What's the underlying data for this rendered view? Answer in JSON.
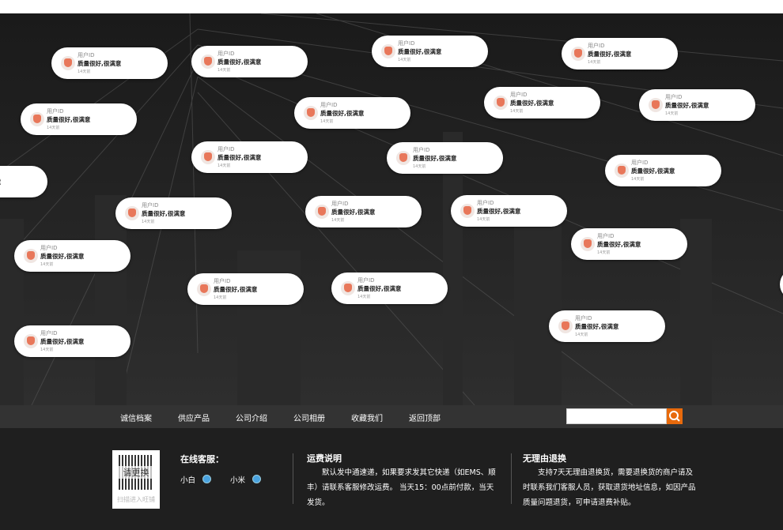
{
  "bubbles": [
    {
      "user": "用户ID",
      "message": "质量很好,很满意",
      "time": "14天前"
    }
  ],
  "nav": {
    "items": [
      "诚信档案",
      "供应产品",
      "公司介绍",
      "公司相册",
      "收藏我们",
      "返回顶部"
    ],
    "search_placeholder": "",
    "search_icon": "search-icon",
    "accent": "#e86a0c"
  },
  "footer": {
    "qr_overlay": "请更换",
    "qr_caption": "扫描进入旺铺",
    "service_title": "在线客服：",
    "agents": [
      {
        "name": "小白",
        "icon": "qq-icon"
      },
      {
        "name": "小米",
        "icon": "qq-icon"
      }
    ],
    "shipping_title": "运费说明",
    "shipping_text": "默认发中通速递，如果要求发其它快递（如EMS、顺丰）请联系客服修改运费。 当天15：00点前付款，当天发货。",
    "return_title": "无理由退换",
    "return_text": "支持7天无理由退换货，需要退换货的商户请及时联系我们客服人员，获取退货地址信息，如因产品质量问题退货，可申请退费补贴。"
  }
}
